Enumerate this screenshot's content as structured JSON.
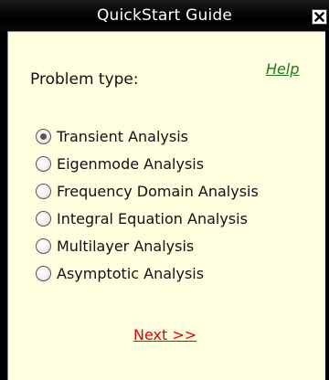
{
  "window": {
    "title": "QuickStart Guide",
    "close_glyph": "✕"
  },
  "content": {
    "problem_type_label": "Problem type:",
    "help_link": "Help",
    "options": [
      {
        "label": "Transient Analysis",
        "selected": true
      },
      {
        "label": "Eigenmode Analysis",
        "selected": false
      },
      {
        "label": "Frequency Domain Analysis",
        "selected": false
      },
      {
        "label": "Integral Equation Analysis",
        "selected": false
      },
      {
        "label": "Multilayer Analysis",
        "selected": false
      },
      {
        "label": "Asymptotic Analysis",
        "selected": false
      }
    ],
    "next_link": "Next >>"
  },
  "colors": {
    "titlebar": "#000000",
    "content_background": "#ffffe0",
    "help_link": "#1f7a1f",
    "next_link": "#e00000"
  },
  "icons": {
    "close": "close-icon",
    "radio": "radio-button-icon"
  }
}
